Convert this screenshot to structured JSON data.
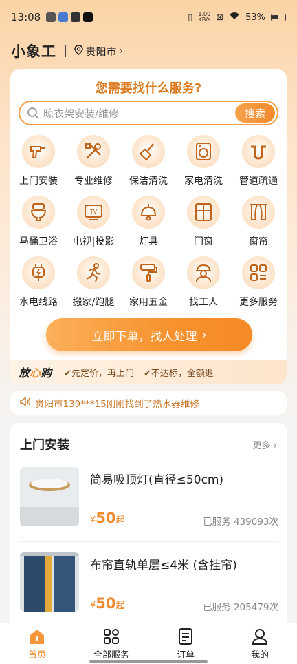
{
  "status_bar": {
    "time": "13:08",
    "net_speed_top": "1.00",
    "net_speed_bottom": "KB/s",
    "battery": "53%"
  },
  "header": {
    "logo": "小象工",
    "city": "贵阳市"
  },
  "main": {
    "title": "您需要找什么服务?",
    "search_placeholder": "晾衣架安装/维修",
    "search_button": "搜索",
    "services": [
      {
        "label": "上门安装",
        "icon": "drill-icon"
      },
      {
        "label": "专业维修",
        "icon": "tools-icon"
      },
      {
        "label": "保洁清洗",
        "icon": "broom-icon"
      },
      {
        "label": "家电清洗",
        "icon": "washing-machine-icon"
      },
      {
        "label": "管道疏通",
        "icon": "pipe-icon"
      },
      {
        "label": "马桶卫浴",
        "icon": "toilet-icon"
      },
      {
        "label": "电视|投影",
        "icon": "tv-icon"
      },
      {
        "label": "灯具",
        "icon": "lamp-icon"
      },
      {
        "label": "门窗",
        "icon": "window-icon"
      },
      {
        "label": "窗帘",
        "icon": "curtain-icon"
      },
      {
        "label": "水电线路",
        "icon": "plug-icon"
      },
      {
        "label": "搬家/跑腿",
        "icon": "running-icon"
      },
      {
        "label": "家用五金",
        "icon": "paint-roller-icon"
      },
      {
        "label": "找工人",
        "icon": "worker-icon"
      },
      {
        "label": "更多服务",
        "icon": "more-grid-icon"
      }
    ],
    "order_button": "立即下单，找人处理",
    "assurance": {
      "brand_a": "放",
      "brand_b": "心",
      "brand_c": "购",
      "item1": "✔先定价，再上门",
      "item2": "✔不达标，全额退"
    }
  },
  "notice": {
    "text": "贵阳市139***15刚刚找到了热水器维修"
  },
  "section": {
    "title": "上门安装",
    "more": "更多",
    "products": [
      {
        "name": "简易吸顶灯(直径≤50cm)",
        "currency": "¥",
        "price": "50",
        "suffix": "起",
        "served": "已服务 439093次"
      },
      {
        "name": "布帘直轨单层≤4米 (含挂帘)",
        "currency": "¥",
        "price": "50",
        "suffix": "起",
        "served": "已服务 205479次"
      }
    ]
  },
  "tabbar": {
    "tabs": [
      {
        "label": "首页",
        "icon": "home-icon"
      },
      {
        "label": "全部服务",
        "icon": "grid-icon"
      },
      {
        "label": "订单",
        "icon": "order-icon"
      },
      {
        "label": "我的",
        "icon": "user-icon"
      }
    ]
  },
  "colors": {
    "accent": "#f08a2c",
    "title_orange": "#d97a1d"
  }
}
